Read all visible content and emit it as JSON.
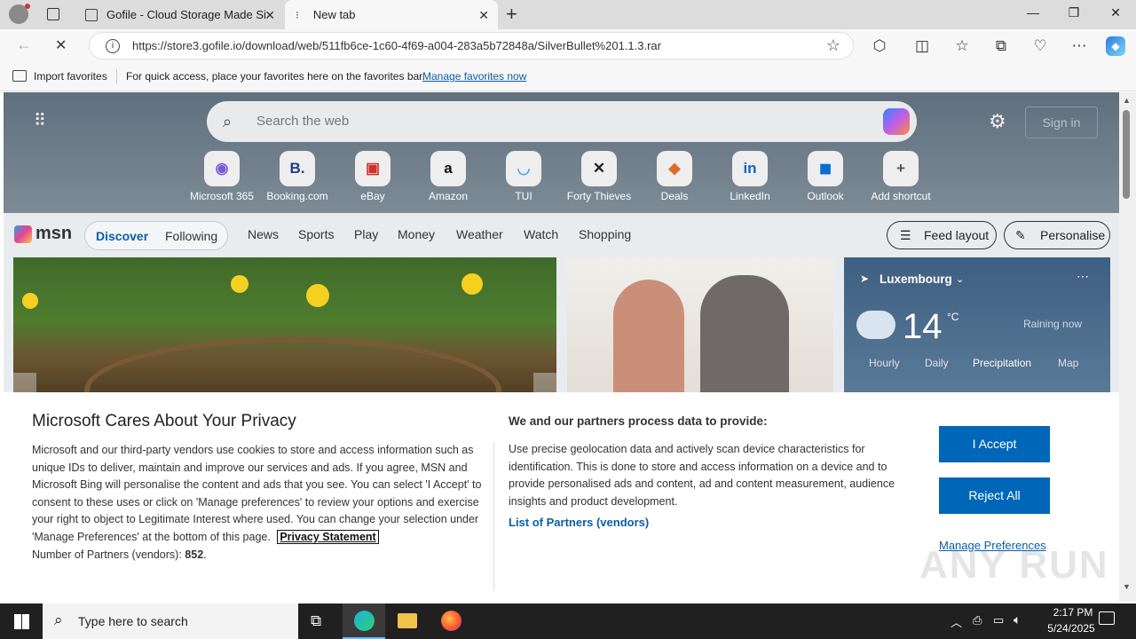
{
  "browser": {
    "tabs": [
      {
        "title": "Gofile - Cloud Storage Made Sim"
      },
      {
        "title": "New tab"
      }
    ],
    "url": "https://store3.gofile.io/download/web/511fb6ce-1c60-4f69-a004-283a5b72848a/SilverBullet%201.1.3.rar",
    "favbar": {
      "import_label": "Import favorites",
      "hint": "For quick access, place your favorites here on the favorites bar.",
      "manage_link": "Manage favorites now"
    }
  },
  "newtab": {
    "search_placeholder": "Search the web",
    "signin_label": "Sign in",
    "shortcuts": [
      {
        "label": "Microsoft 365",
        "icon": "m365-icon",
        "glyph": "◉",
        "color": "#7b5ad6"
      },
      {
        "label": "Booking.com",
        "icon": "booking-icon",
        "glyph": "B.",
        "color": "#1a3f8a"
      },
      {
        "label": "eBay",
        "icon": "ebay-icon",
        "glyph": "▣",
        "color": "#d0312d"
      },
      {
        "label": "Amazon",
        "icon": "amazon-icon",
        "glyph": "a",
        "color": "#111111"
      },
      {
        "label": "TUI",
        "icon": "tui-icon",
        "glyph": "◡",
        "color": "#58a6e0"
      },
      {
        "label": "Forty Thieves",
        "icon": "forty-thieves-icon",
        "glyph": "✕",
        "color": "#222222"
      },
      {
        "label": "Deals",
        "icon": "deals-icon",
        "glyph": "◆",
        "color": "#e06a2b"
      },
      {
        "label": "LinkedIn",
        "icon": "linkedin-icon",
        "glyph": "in",
        "color": "#0a66c2"
      },
      {
        "label": "Outlook",
        "icon": "outlook-icon",
        "glyph": "◼",
        "color": "#0a6ed1"
      },
      {
        "label": "Add shortcut",
        "icon": "plus-icon",
        "glyph": "+",
        "color": "#555555"
      }
    ],
    "msn": {
      "logo_text": "msn",
      "tabs": [
        "Discover",
        "Following"
      ],
      "nav": [
        "News",
        "Sports",
        "Play",
        "Money",
        "Weather",
        "Watch",
        "Shopping"
      ],
      "feed_layout": "Feed layout",
      "personalise": "Personalise"
    },
    "weather": {
      "location": "Luxembourg",
      "temp": "14",
      "unit": "°C",
      "condition": "Raining now",
      "tabs": [
        "Hourly",
        "Daily",
        "Precipitation",
        "Map"
      ]
    }
  },
  "privacy": {
    "title": "Microsoft Cares About Your Privacy",
    "body": "Microsoft and our third-party vendors use cookies to store and access information such as unique IDs to deliver, maintain and improve our services and ads. If you agree, MSN and Microsoft Bing will personalise the content and ads that you see. You can select 'I Accept' to consent to these uses or click on 'Manage preferences' to review your options and exercise your right to object to Legitimate Interest where used.  You can change your selection under 'Manage Preferences' at the bottom of this page.",
    "statement_link": "Privacy Statement",
    "partners_label": "Number of Partners (vendors):",
    "partners_count": "852",
    "partners_suffix": ".",
    "right_title": "We and our partners process data to provide:",
    "right_body": "Use precise geolocation data and actively scan device characteristics for identification. This is done to store and access information on a device and to provide personalised ads and content, ad and content measurement, audience insights and product development.",
    "partners_link": "List of Partners (vendors)",
    "accept": "I Accept",
    "reject": "Reject All",
    "manage": "Manage Preferences"
  },
  "taskbar": {
    "search_placeholder": "Type here to search",
    "time": "2:17 PM",
    "date": "5/24/2025"
  },
  "watermark": "ANY RUN",
  "colors": {
    "accent": "#0067b8",
    "link": "#0b5ea8"
  }
}
